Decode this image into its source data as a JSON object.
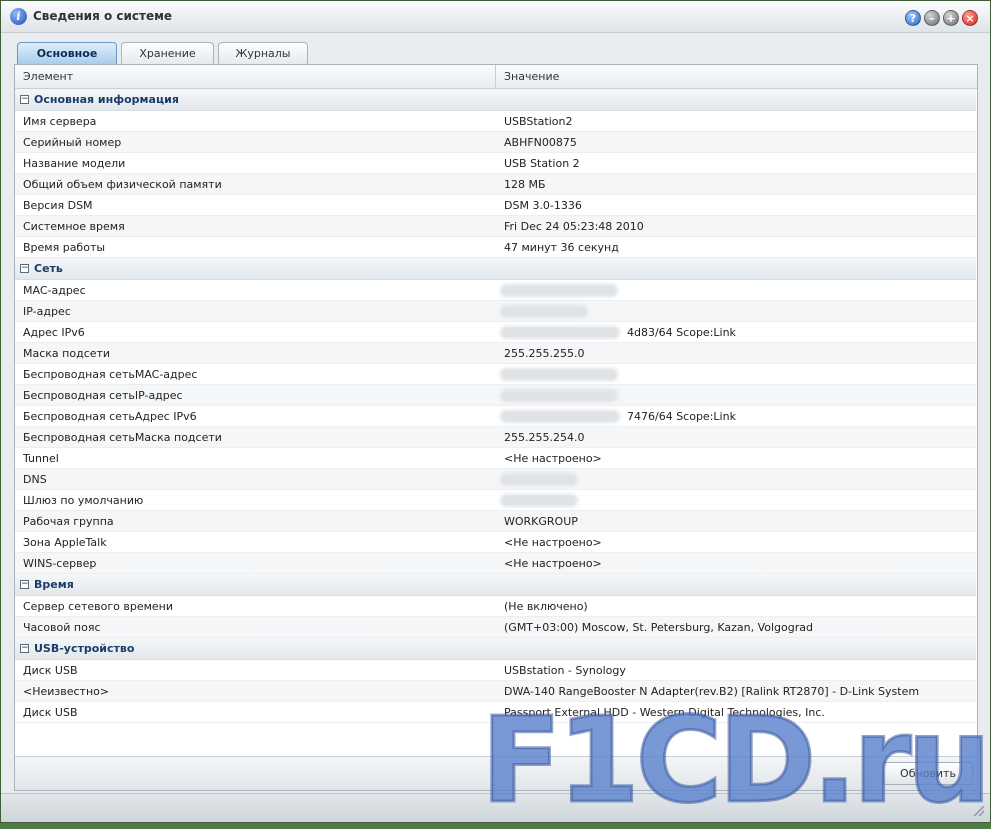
{
  "window": {
    "title": "Сведения о системе",
    "buttons": [
      "help",
      "minimize",
      "maximize",
      "close"
    ],
    "help_glyph": "?",
    "min_glyph": "–",
    "max_glyph": "+",
    "close_glyph": "×",
    "title_icon_glyph": "i"
  },
  "tabs": [
    {
      "label": "Основное",
      "active": true
    },
    {
      "label": "Хранение",
      "active": false
    },
    {
      "label": "Журналы",
      "active": false
    }
  ],
  "grid": {
    "col_element": "Элемент",
    "col_value": "Значение",
    "groups": [
      {
        "label": "Основная информация",
        "rows": [
          {
            "name": "Имя сервера",
            "value": "USBStation2"
          },
          {
            "name": "Серийный номер",
            "value": "ABHFN00875"
          },
          {
            "name": "Название модели",
            "value": "USB Station 2"
          },
          {
            "name": "Общий объем физической памяти",
            "value": "128 МБ"
          },
          {
            "name": "Версия DSM",
            "value": "DSM 3.0-1336"
          },
          {
            "name": "Системное время",
            "value": "Fri Dec 24 05:23:48 2010"
          },
          {
            "name": "Время работы",
            "value": "47 минут 36 секунд"
          }
        ]
      },
      {
        "label": "Сеть",
        "rows": [
          {
            "name": "MAC-адрес",
            "value": ""
          },
          {
            "name": "IP-адрес",
            "value": ""
          },
          {
            "name": "Адрес IPv6",
            "value": "4d83/64 Scope:Link"
          },
          {
            "name": "Маска подсети",
            "value": "255.255.255.0"
          },
          {
            "name": "Беспроводная сетьMAC-адрес",
            "value": ""
          },
          {
            "name": "Беспроводная сетьIP-адрес",
            "value": ""
          },
          {
            "name": "Беспроводная сетьАдрес IPv6",
            "value": "7476/64 Scope:Link"
          },
          {
            "name": "Беспроводная сетьМаска подсети",
            "value": "255.255.254.0"
          },
          {
            "name": "Tunnel",
            "value": "<Не настроено>"
          },
          {
            "name": "DNS",
            "value": ""
          },
          {
            "name": "Шлюз по умолчанию",
            "value": ""
          },
          {
            "name": "Рабочая группа",
            "value": "WORKGROUP"
          },
          {
            "name": "Зона AppleTalk",
            "value": "<Не настроено>"
          },
          {
            "name": "WINS-сервер",
            "value": "<Не настроено>"
          }
        ]
      },
      {
        "label": "Время",
        "rows": [
          {
            "name": "Сервер сетевого времени",
            "value": "(Не включено)"
          },
          {
            "name": "Часовой пояс",
            "value": "(GMT+03:00) Moscow, St. Petersburg, Kazan, Volgograd"
          }
        ]
      },
      {
        "label": "USB-устройство",
        "rows": [
          {
            "name": "Диск USB",
            "value": "USBstation - Synology"
          },
          {
            "name": "<Неизвестно>",
            "value": "DWA-140 RangeBooster N Adapter(rev.B2) [Ralink RT2870] - D-Link System"
          },
          {
            "name": "Диск USB",
            "value": "Passport External HDD - Western Digital Technologies, Inc."
          }
        ]
      }
    ]
  },
  "footer": {
    "refresh_label": "Обновить"
  },
  "watermark": "F1CD.ru",
  "colors": {
    "accent": "#1a3c66",
    "active_tab": "#a9cdeb",
    "watermark": "#5c82cd"
  }
}
